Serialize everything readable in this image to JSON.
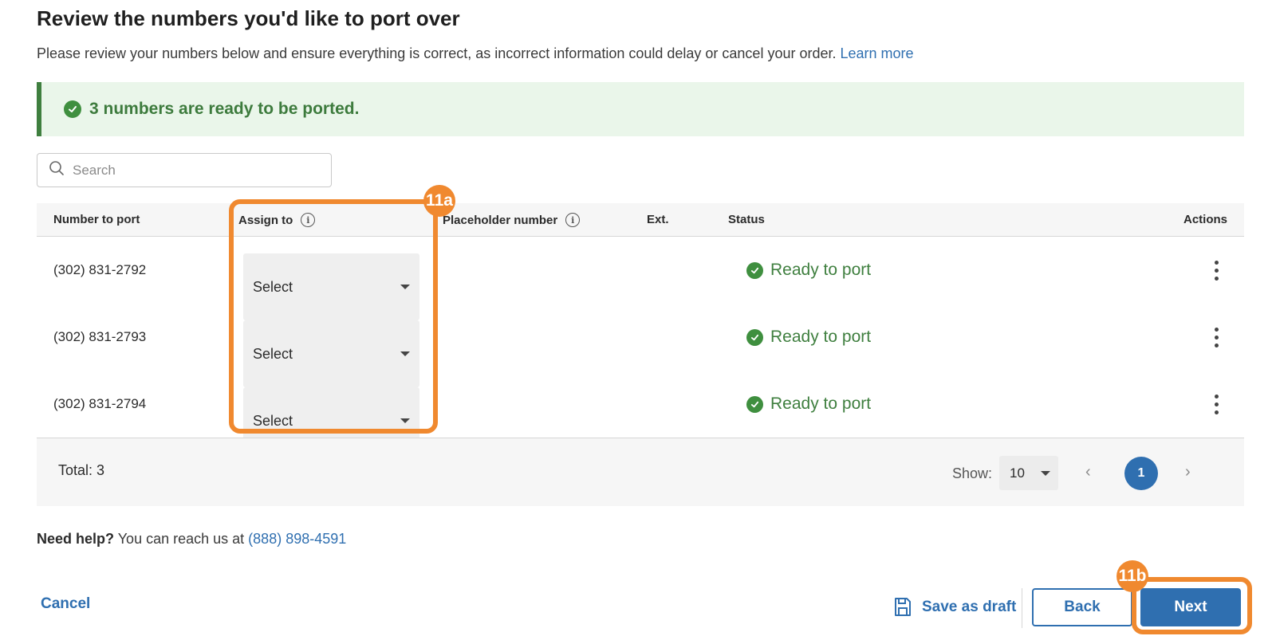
{
  "header": {
    "title": "Review the numbers you'd like to port over",
    "subtitle": "Please review your numbers below and ensure everything is correct, as incorrect information could delay or cancel your order.",
    "learn_more": "Learn more"
  },
  "banner": {
    "text": "3 numbers are ready to be ported.",
    "icon": "check-circle-icon",
    "color": "#3d7b3d"
  },
  "search": {
    "placeholder": "Search",
    "value": ""
  },
  "table": {
    "headers": {
      "number": "Number to port",
      "assign": "Assign to",
      "placeholder": "Placeholder number",
      "ext": "Ext.",
      "status": "Status",
      "actions": "Actions"
    },
    "rows": [
      {
        "number": "(302) 831-2792",
        "assign": "Select",
        "status": "Ready to port"
      },
      {
        "number": "(302) 831-2793",
        "assign": "Select",
        "status": "Ready to port"
      },
      {
        "number": "(302) 831-2794",
        "assign": "Select",
        "status": "Ready to port"
      }
    ],
    "footer": {
      "total": "Total: 3",
      "show_label": "Show:",
      "show_value": "10",
      "current_page": "1"
    }
  },
  "help": {
    "bold": "Need help?",
    "text": "You can reach us at",
    "phone": "(888) 898-4591"
  },
  "actions": {
    "cancel": "Cancel",
    "save_draft": "Save as draft",
    "back": "Back",
    "next": "Next"
  },
  "annotations": {
    "a": "11a",
    "b": "11b",
    "color": "#f0892f"
  },
  "colors": {
    "accent": "#2f6fb0",
    "success": "#3f8f3f"
  }
}
